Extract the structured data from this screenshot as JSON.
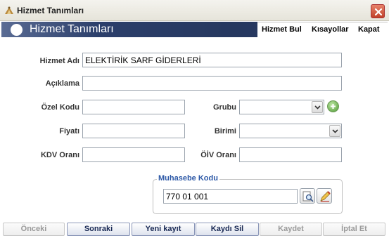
{
  "window": {
    "title": "Hizmet Tanımları"
  },
  "header": {
    "title": "Hizmet Tanımları"
  },
  "menu": {
    "items": [
      "Hizmet Bul",
      "Kısayollar",
      "Kapat"
    ]
  },
  "form": {
    "hizmet_adi": {
      "label": "Hizmet Adı",
      "value": "ELEKTİRİK SARF GİDERLERİ"
    },
    "aciklama": {
      "label": "Açıklama",
      "value": ""
    },
    "ozel_kodu": {
      "label": "Özel Kodu",
      "value": ""
    },
    "grubu": {
      "label": "Grubu",
      "value": ""
    },
    "fiyati": {
      "label": "Fiyatı",
      "value": ""
    },
    "birimi": {
      "label": "Birimi",
      "value": ""
    },
    "kdv_orani": {
      "label": "KDV Oranı",
      "value": ""
    },
    "oiv_orani": {
      "label": "ÖİV Oranı",
      "value": ""
    },
    "muhasebe": {
      "legend": "Muhasebe Kodu",
      "value": "770 01 001"
    }
  },
  "buttons": {
    "onceki": "Önceki",
    "sonraki": "Sonraki",
    "yeni_kayit": "Yeni kayıt",
    "kaydi_sil": "Kaydı Sil",
    "kaydet": "Kaydet",
    "iptal_et": "İptal Et"
  },
  "colors": {
    "header_dark": "#26385f",
    "header_light": "#5a6c94",
    "group_legend": "#2b57a6",
    "add_green": "#4f9a35",
    "close_red": "#c0412a"
  },
  "icons": [
    "app-icon",
    "close-icon",
    "add-icon",
    "search-icon",
    "edit-icon",
    "chevron-down-icon"
  ]
}
